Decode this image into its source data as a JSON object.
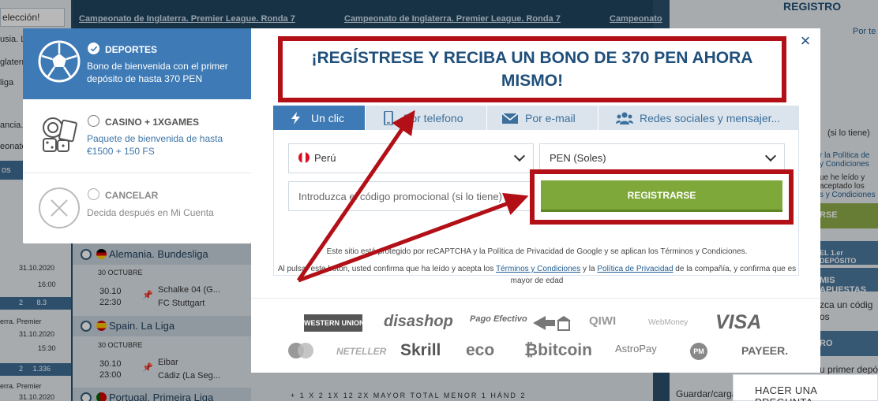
{
  "background": {
    "left_column": {
      "select_value": "elección!",
      "items": [
        "usia. Le",
        "glaterr",
        "liga",
        "ancia.",
        "eonato",
        "os"
      ],
      "dates": [
        "31.10.2020",
        "16:00",
        "erra. Premier",
        "31.10.2020",
        "15:30",
        "erra. Premier",
        "31.10.2020"
      ],
      "odds": [
        "2",
        "8.3",
        "2",
        "1.336"
      ]
    },
    "top_tabs": [
      "Campeonato de Inglaterra. Premier League. Ronda 7",
      "Campeonato de Inglaterra. Premier League. Ronda 7",
      "Campeonato"
    ],
    "leagues": [
      {
        "name": "Alemania. Bundesliga",
        "date_label": "30 OCTUBRE",
        "match": {
          "date": "30.10",
          "time": "22:30",
          "home": "Schalke 04 (G...",
          "away": "FC Stuttgart"
        }
      },
      {
        "name": "Spain. La Liga",
        "date_label": "30 OCTUBRE",
        "match": {
          "date": "30.10",
          "time": "23:00",
          "home": "Eibar",
          "away": "Cádiz (La Seg..."
        }
      },
      {
        "name": "Portugal. Primeira Liga"
      }
    ],
    "odds_header": "+   1   X   2   1X   12   2X   MAYOR  TOTAL  MENOR   1   HÁND   2",
    "right_panel": {
      "title": "REGISTRO",
      "by_phone": "Por te",
      "lines": [
        "(si lo tiene)",
        "r la Política de",
        "y Condiciones",
        "ue he leído y",
        "aceptado los",
        "s y Condiciones"
      ],
      "register": "RSE",
      "first_deposit": "EL 1.er DEPÓSITO",
      "more_bets": "MIS APUESTAS",
      "promo_text": "zca un códig",
      "promo_text2": "os",
      "register2": "RO",
      "promo_text3": "u primer depó",
      "save": "Guardar/carga"
    }
  },
  "bonus_panel": {
    "options": [
      {
        "title": "DEPORTES",
        "description": "Bono de bienvenida con el primer depósito de hasta 370 PEN",
        "selected": true,
        "icon": "soccer-ball-icon"
      },
      {
        "title": "CASINO + 1XGAMES",
        "description": "Paquete de bienvenida de hasta €1500 + 150 FS",
        "selected": false,
        "icon": "casino-chips-icon"
      },
      {
        "title": "CANCELAR",
        "description": "Decida después en Mi Cuenta",
        "selected": false,
        "icon": "cancel-x-icon"
      }
    ]
  },
  "modal": {
    "headline": "¡REGÍSTRESE Y RECIBA UN BONO DE 370 PEN AHORA MISMO!",
    "close_icon": "×",
    "tabs": [
      {
        "label": "Un clic",
        "icon": "lightning-icon",
        "active": true
      },
      {
        "label": "Por telefono",
        "icon": "phone-icon",
        "active": false
      },
      {
        "label": "Por e-mail",
        "icon": "envelope-icon",
        "active": false
      },
      {
        "label": "Redes sociales y mensajer...",
        "icon": "people-icon",
        "active": false
      }
    ],
    "country": "Perú",
    "currency": "PEN (Soles)",
    "promo_placeholder": "Introduzca el código promocional (si lo tiene)",
    "register_button": "REGISTRARSE",
    "recaptcha_text": "Este sitio está protegido por reCAPTCHA y la Política de Privacidad de Google y se aplican los Términos y Condiciones.",
    "legal": {
      "prefix": "Al pulsar este botón, usted confirma que ha leído y acepta los",
      "terms": "Términos y Condiciones",
      "middle": "y la",
      "privacy": "Política de Privacidad",
      "suffix": "de la compañía, y confirma que es mayor de edad"
    },
    "payments": [
      "WESTERN UNION",
      "disashop",
      "Pago Efectivo",
      "",
      "QIWI",
      "WebMoney",
      "VISA",
      "",
      "NETELLER",
      "Skrill",
      "eco",
      "bitcoin",
      "AstroPay",
      "PM",
      "PAYEER."
    ]
  },
  "ask_question": "HACER UNA PREGUNTA",
  "colors": {
    "accent_blue": "#3e7ab5",
    "register_green": "#7fa83a",
    "highlight_red": "#b20f17",
    "headline_text": "#1f4f7b"
  }
}
